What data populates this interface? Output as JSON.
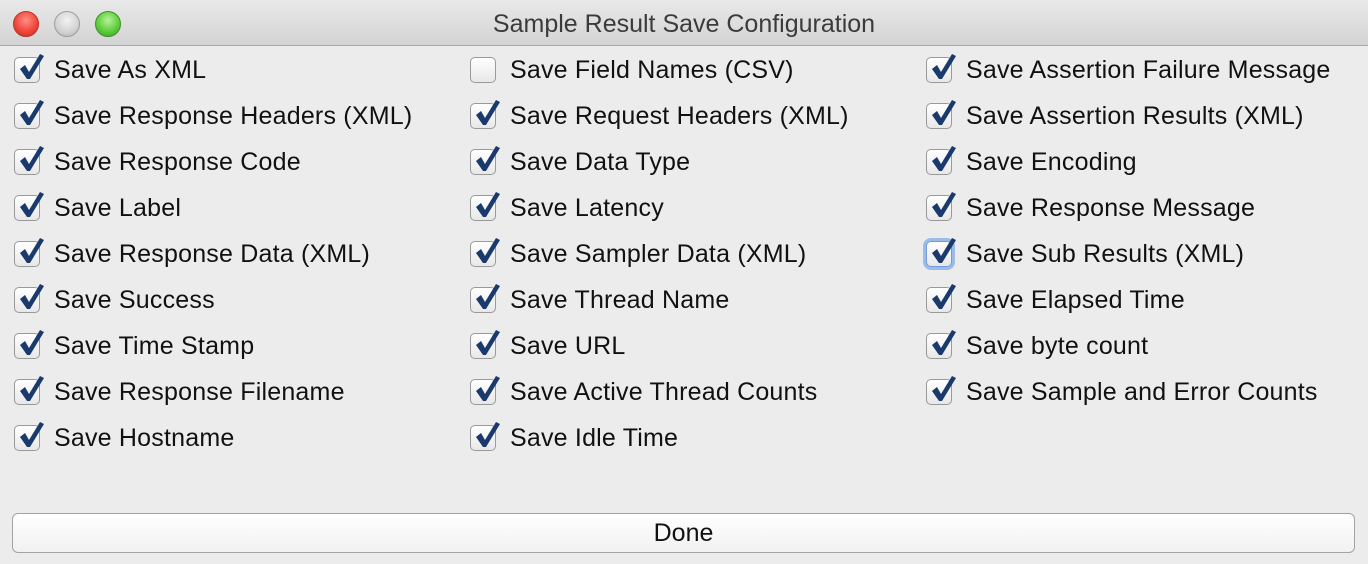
{
  "window": {
    "title": "Sample Result Save Configuration"
  },
  "colors": {
    "check": "#1a3a6e",
    "focus_ring": "#5a96e6"
  },
  "columns": [
    {
      "items": [
        {
          "label": "Save As XML",
          "checked": true
        },
        {
          "label": "Save Response Headers (XML)",
          "checked": true
        },
        {
          "label": "Save Response Code",
          "checked": true
        },
        {
          "label": "Save Label",
          "checked": true
        },
        {
          "label": "Save Response Data (XML)",
          "checked": true
        },
        {
          "label": "Save Success",
          "checked": true
        },
        {
          "label": "Save Time Stamp",
          "checked": true
        },
        {
          "label": "Save Response Filename",
          "checked": true
        },
        {
          "label": "Save Hostname",
          "checked": true
        }
      ]
    },
    {
      "items": [
        {
          "label": "Save Field Names (CSV)",
          "checked": false
        },
        {
          "label": "Save Request Headers (XML)",
          "checked": true
        },
        {
          "label": "Save Data Type",
          "checked": true
        },
        {
          "label": "Save Latency",
          "checked": true
        },
        {
          "label": "Save Sampler Data (XML)",
          "checked": true
        },
        {
          "label": "Save Thread Name",
          "checked": true
        },
        {
          "label": "Save URL",
          "checked": true
        },
        {
          "label": "Save Active Thread Counts",
          "checked": true
        },
        {
          "label": "Save Idle Time",
          "checked": true
        }
      ]
    },
    {
      "items": [
        {
          "label": "Save Assertion Failure Message",
          "checked": true
        },
        {
          "label": "Save Assertion Results (XML)",
          "checked": true
        },
        {
          "label": "Save Encoding",
          "checked": true
        },
        {
          "label": "Save Response Message",
          "checked": true
        },
        {
          "label": "Save Sub Results (XML)",
          "checked": true,
          "focused": true
        },
        {
          "label": "Save Elapsed Time",
          "checked": true
        },
        {
          "label": "Save byte count",
          "checked": true
        },
        {
          "label": "Save Sample and Error Counts",
          "checked": true
        }
      ]
    }
  ],
  "done_button": {
    "label": "Done"
  }
}
